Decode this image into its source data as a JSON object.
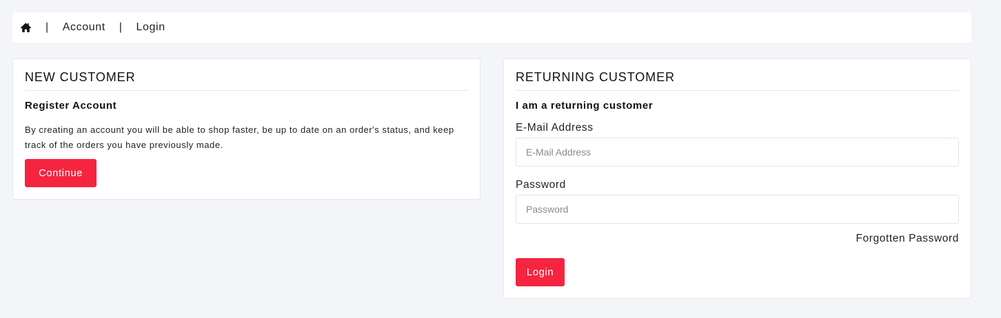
{
  "breadcrumb": {
    "home_icon": "home-icon",
    "separator": "|",
    "items": [
      {
        "label": "Account"
      },
      {
        "label": "Login"
      }
    ]
  },
  "new_customer": {
    "title": "NEW CUSTOMER",
    "subtitle": "Register Account",
    "description": "By creating an account you will be able to shop faster, be up to date on an order's status, and keep track of the orders you have previously made.",
    "button_label": "Continue"
  },
  "returning_customer": {
    "title": "RETURNING CUSTOMER",
    "subtitle": "I am a returning customer",
    "email_label": "E-Mail Address",
    "email_placeholder": "E-Mail Address",
    "email_value": "",
    "password_label": "Password",
    "password_placeholder": "Password",
    "password_value": "",
    "forgot_label": "Forgotten Password",
    "button_label": "Login"
  },
  "colors": {
    "accent": "#f52540",
    "background": "#f4f5f9",
    "panel": "#ffffff",
    "border": "#e6e7eb"
  }
}
